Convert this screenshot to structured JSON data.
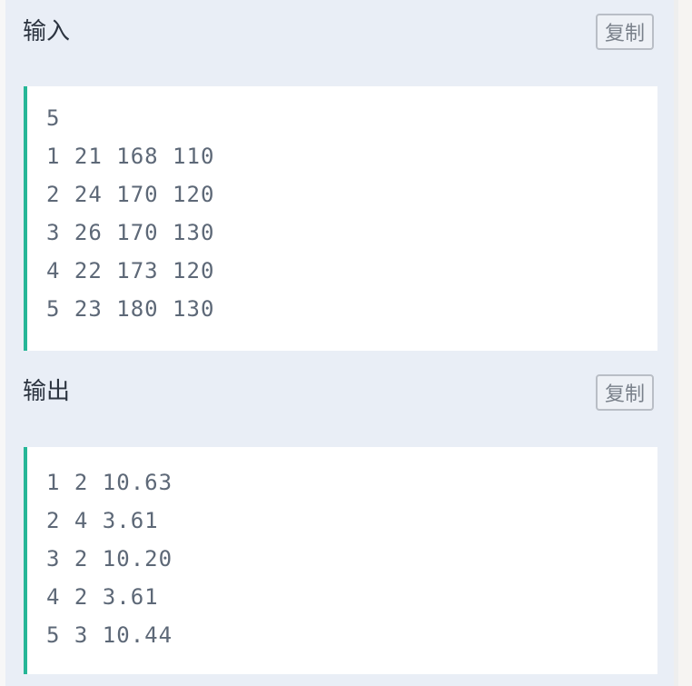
{
  "input_section": {
    "title": "输入",
    "copy_label": "复制",
    "lines": [
      "5",
      "1 21 168 110",
      "2 24 170 120",
      "3 26 170 130",
      "4 22 173 120",
      "5 23 180 130"
    ]
  },
  "output_section": {
    "title": "输出",
    "copy_label": "复制",
    "lines": [
      "1 2 10.63",
      "2 4 3.61",
      "3 2 10.20",
      "4 2 3.61",
      "5 3 10.44"
    ]
  },
  "colors": {
    "panel_bg": "#e9eef6",
    "code_bg": "#ffffff",
    "accent_border": "#26b697",
    "code_text": "#5d6877",
    "title_text": "#2c3440"
  }
}
